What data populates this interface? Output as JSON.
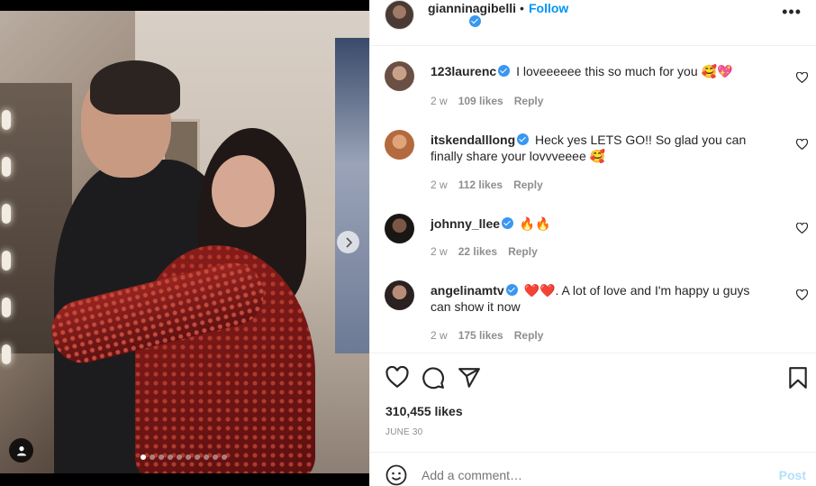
{
  "post": {
    "username": "giannina­gibelli",
    "username_display": "gianninagibelli",
    "follow_label": "Follow",
    "separator": "•",
    "more_label": "•••",
    "carousel_total": 10,
    "carousel_active": 1
  },
  "comments": [
    {
      "username": "123laurenc",
      "text": "I loveeeeee this so much for you 🥰💖",
      "time": "2 w",
      "likes": "109 likes",
      "reply": "Reply"
    },
    {
      "username": "itskendalllong",
      "text": "Heck yes LETS GO!! So glad you can finally share your lovvveeee 🥰",
      "time": "2 w",
      "likes": "112 likes",
      "reply": "Reply"
    },
    {
      "username": "johnny_llee",
      "text": "🔥🔥",
      "time": "2 w",
      "likes": "22 likes",
      "reply": "Reply"
    },
    {
      "username": "angelinamtv",
      "text": "❤️❤️. A lot of love and I'm happy u guys can show it now",
      "time": "2 w",
      "likes": "175 likes",
      "reply": "Reply"
    }
  ],
  "actions": {
    "likes": "310,455 likes",
    "date": "JUNE 30"
  },
  "composer": {
    "placeholder": "Add a comment…",
    "post_label": "Post"
  },
  "colors": {
    "accent": "#0095f6",
    "verified": "#3897f0",
    "muted": "#8e8e8e",
    "post_disabled": "#b2dffc"
  }
}
